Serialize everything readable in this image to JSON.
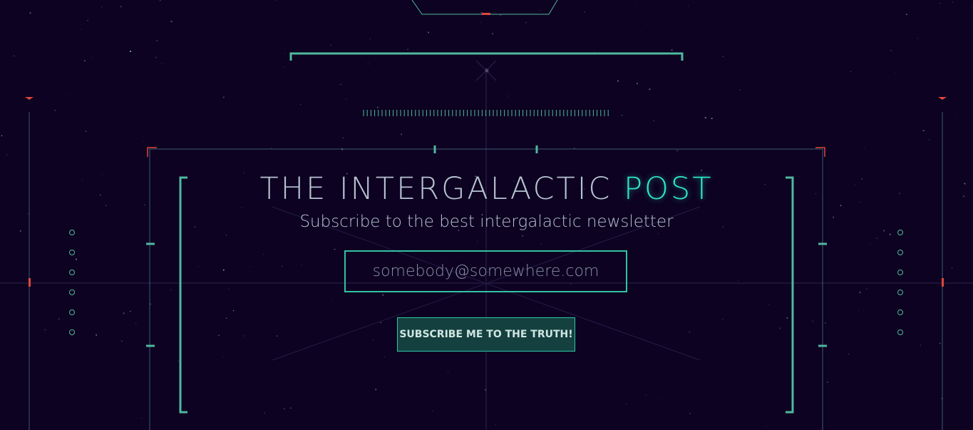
{
  "newsletter": {
    "title_main": "THE INTERGALACTIC ",
    "title_accent": "POST",
    "subtitle": "Subscribe to the best intergalactic newsletter",
    "email_placeholder": "somebody@somewhere.com",
    "subscribe_label": "SUBSCRIBE ME TO THE TRUTH!"
  },
  "colors": {
    "background": "#0d0221",
    "teal": "#4fb8a0",
    "teal_bright": "#2ee8c4",
    "frame": "#3b5b78",
    "red": "#e0463a",
    "text": "#b6c2d2"
  }
}
